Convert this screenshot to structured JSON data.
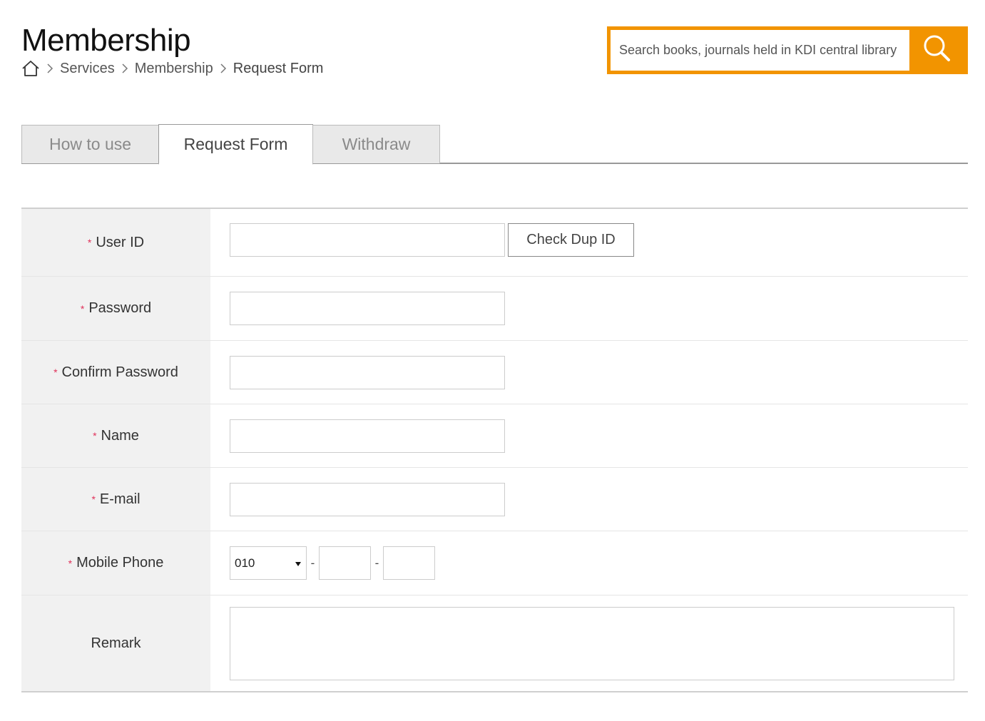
{
  "page": {
    "title": "Membership"
  },
  "breadcrumb": {
    "home_icon": "home-icon",
    "items": [
      "Services",
      "Membership",
      "Request Form"
    ]
  },
  "search": {
    "placeholder": "Search books, journals held in KDI central library",
    "button_icon": "search-icon",
    "accent_color": "#f29400"
  },
  "tabs": [
    {
      "label": "How to use",
      "active": false
    },
    {
      "label": "Request Form",
      "active": true
    },
    {
      "label": "Withdraw",
      "active": false
    }
  ],
  "form": {
    "required_marker": "*",
    "required_color": "#e0315a",
    "user_id": {
      "label": "User ID",
      "value": "",
      "check_button": "Check Dup ID"
    },
    "password": {
      "label": "Password",
      "value": ""
    },
    "confirm_password": {
      "label": "Confirm Password",
      "value": ""
    },
    "name": {
      "label": "Name",
      "value": ""
    },
    "email": {
      "label": "E-mail",
      "value": ""
    },
    "mobile_phone": {
      "label": "Mobile Phone",
      "prefix_selected": "010",
      "separator": "-",
      "middle": "",
      "last": ""
    },
    "remark": {
      "label": "Remark",
      "value": ""
    }
  }
}
